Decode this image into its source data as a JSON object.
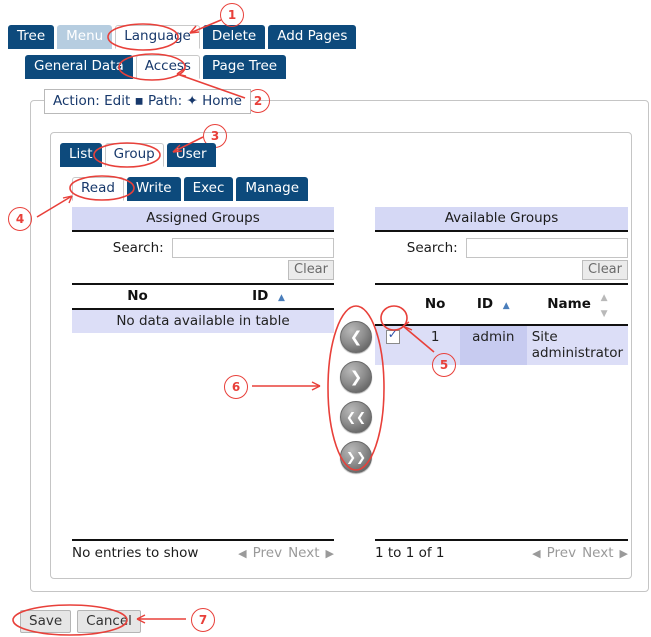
{
  "toolbar": {
    "row1": [
      {
        "label": "Tree",
        "state": "normal"
      },
      {
        "label": "Menu",
        "state": "dim"
      },
      {
        "label": "Language",
        "state": "selected"
      },
      {
        "label": "Delete",
        "state": "normal"
      },
      {
        "label": "Add Pages",
        "state": "normal"
      }
    ],
    "row2": [
      {
        "label": "General Data",
        "state": "normal"
      },
      {
        "label": "Access",
        "state": "selected"
      },
      {
        "label": "Page Tree",
        "state": "normal"
      }
    ]
  },
  "actionbar": {
    "text_before": "Action: Edit",
    "separator": "▪",
    "path_label": "Path:",
    "diamond": "✦",
    "path_value": "Home",
    "full": "Action: Edit ▪ Path: ✦ Home"
  },
  "scope_tabs": [
    {
      "label": "List",
      "state": "normal"
    },
    {
      "label": "Group",
      "state": "selected"
    },
    {
      "label": "User",
      "state": "normal"
    }
  ],
  "perm_tabs": [
    {
      "label": "Read",
      "state": "selected"
    },
    {
      "label": "Write",
      "state": "normal"
    },
    {
      "label": "Exec",
      "state": "normal"
    },
    {
      "label": "Manage",
      "state": "normal"
    }
  ],
  "assigned": {
    "title": "Assigned Groups",
    "search_label": "Search:",
    "search_value": "",
    "search_placeholder": "",
    "clear_label": "Clear",
    "columns": [
      "No",
      "ID"
    ],
    "sort_column": "ID",
    "sort_direction": "asc",
    "empty_message": "No data available in table",
    "rows": [],
    "footer_info": "No entries to show",
    "prev_label": "Prev",
    "next_label": "Next"
  },
  "available": {
    "title": "Available Groups",
    "search_label": "Search:",
    "search_value": "",
    "search_placeholder": "",
    "clear_label": "Clear",
    "columns": [
      "",
      "No",
      "ID",
      "Name"
    ],
    "sort_column": "ID",
    "sort_direction": "asc",
    "rows": [
      {
        "checked": true,
        "no": "1",
        "id": "admin",
        "name": "Site administrator"
      }
    ],
    "footer_info": "1 to 1 of 1",
    "prev_label": "Prev",
    "next_label": "Next"
  },
  "transfer_buttons": [
    {
      "icon": "chevron-left",
      "glyph": "❮"
    },
    {
      "icon": "chevron-right",
      "glyph": "❯"
    },
    {
      "icon": "chevron-double-left",
      "glyph": "❮❮"
    },
    {
      "icon": "chevron-double-right",
      "glyph": "❯❯"
    }
  ],
  "footer_buttons": [
    {
      "label": "Save"
    },
    {
      "label": "Cancel"
    }
  ],
  "annotations": [
    {
      "number": "1"
    },
    {
      "number": "2"
    },
    {
      "number": "3"
    },
    {
      "number": "4"
    },
    {
      "number": "5"
    },
    {
      "number": "6"
    },
    {
      "number": "7"
    }
  ],
  "colors": {
    "tab_navy": "#0d4a7c",
    "tab_dim": "#b6cde0",
    "table_title_bg": "#d5d8f5",
    "row_bg": "#dcdef7",
    "sorted_col_bg": "#c7cbf0",
    "annotation_red": "#e8403a",
    "action_text": "#17386b"
  }
}
